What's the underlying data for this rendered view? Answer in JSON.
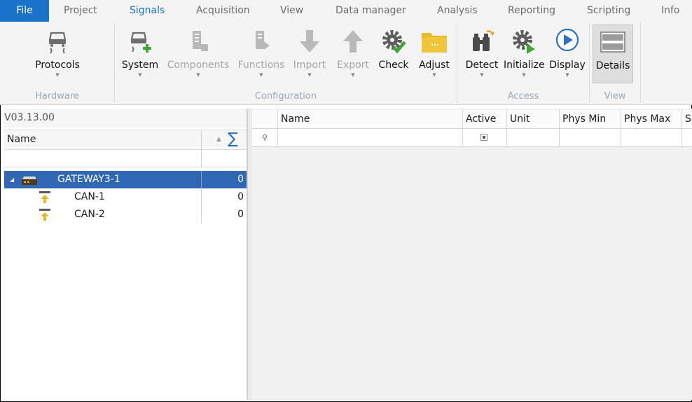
{
  "menu": {
    "tabs": [
      {
        "label": "File"
      },
      {
        "label": "Project"
      },
      {
        "label": "Signals"
      },
      {
        "label": "Acquisition"
      },
      {
        "label": "View"
      },
      {
        "label": "Data manager"
      },
      {
        "label": "Analysis"
      },
      {
        "label": "Reporting"
      },
      {
        "label": "Scripting"
      },
      {
        "label": "Info"
      }
    ],
    "active_tab": "Signals"
  },
  "ribbon": {
    "groups": {
      "hardware": "Hardware",
      "configuration": "Configuration",
      "access": "Access",
      "view": "View"
    },
    "buttons": {
      "protocols": "Protocols",
      "system": "System",
      "components": "Components",
      "functions": "Functions",
      "import": "Import",
      "export": "Export",
      "check": "Check",
      "adjust": "Adjust",
      "detect": "Detect",
      "initialize": "Initialize",
      "display": "Display",
      "details": "Details"
    }
  },
  "tree": {
    "version": "V03.13.00",
    "column_name": "Name",
    "rows": [
      {
        "label": "GATEWAY3-1",
        "value": "0"
      },
      {
        "label": "CAN-1",
        "value": "0"
      },
      {
        "label": "CAN-2",
        "value": "0"
      }
    ]
  },
  "grid": {
    "columns": [
      "Name",
      "Active",
      "Unit",
      "Phys Min",
      "Phys Max",
      "S"
    ]
  },
  "colors": {
    "accent": "#1a73c9",
    "selection": "#2f67b5",
    "gear_green": "#3fa535",
    "folder_yellow": "#e8b92a"
  }
}
